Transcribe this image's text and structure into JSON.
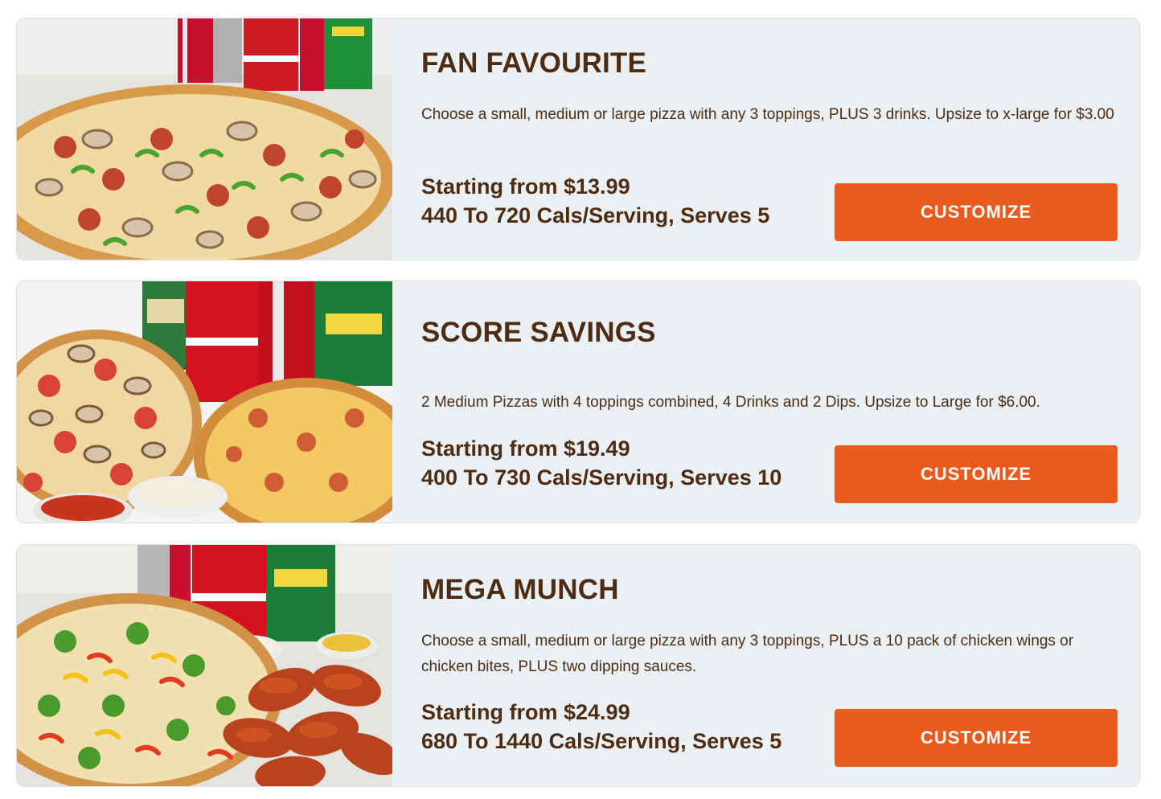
{
  "deals": [
    {
      "title": "FAN FAVOURITE",
      "description": "Choose a small, medium or large pizza with any 3 toppings, PLUS 3 drinks. Upsize to x-large for $3.00",
      "price": "Starting from $13.99",
      "calories": "440 To 720 Cals/Serving, Serves 5",
      "button_label": "CUSTOMIZE",
      "image_icon": "pizza-with-drinks-image"
    },
    {
      "title": "SCORE SAVINGS",
      "description": "2 Medium Pizzas with 4 toppings combined, 4 Drinks and 2 Dips. Upsize to Large for $6.00.",
      "price": "Starting from $19.49",
      "calories": "400 To 730 Cals/Serving, Serves 10",
      "button_label": "CUSTOMIZE",
      "image_icon": "two-pizzas-drinks-dips-image"
    },
    {
      "title": "MEGA MUNCH",
      "description": "Choose a small, medium or large pizza with any 3 toppings, PLUS a 10 pack of chicken wings or chicken bites, PLUS two dipping sauces.",
      "price": "Starting from $24.99",
      "calories": "680 To 1440 Cals/Serving, Serves 5",
      "button_label": "CUSTOMIZE",
      "image_icon": "pizza-wings-drinks-image"
    }
  ],
  "colors": {
    "card_background": "#eaf0f3",
    "heading_text": "#4e2c12",
    "button_background": "#e85b1c",
    "button_text": "#ffffff"
  }
}
